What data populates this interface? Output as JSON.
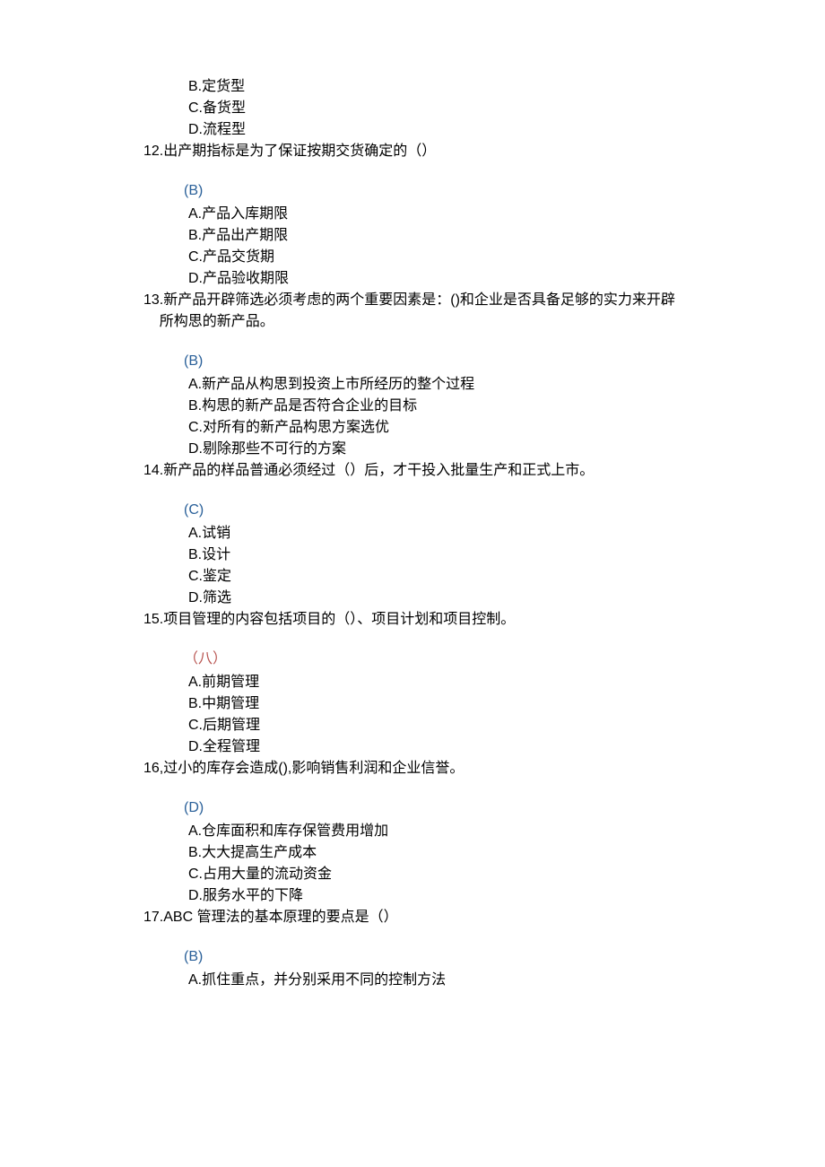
{
  "partial_options": [
    "B.定货型",
    "C.备货型",
    "D.流程型"
  ],
  "questions": [
    {
      "num": "12. ",
      "text": "出产期指标是为了保证按期交货确定的（）",
      "answer": "(B)",
      "answer_style": "blue",
      "options": [
        "A.产品入库期限",
        "B.产品出产期限",
        "C.产品交货期",
        "D.产品验收期限"
      ]
    },
    {
      "num": "13 ",
      "text": ".新产品开辟筛选必须考虑的两个重要因素是：()和企业是否具备足够的实力来开辟所构思的新产品。",
      "answer": "(B)",
      "answer_style": "blue",
      "options": [
        "A.新产品从构思到投资上市所经历的整个过程",
        "B.构思的新产品是否符合企业的目标",
        "C.对所有的新产品构思方案选优",
        "D.剔除那些不可行的方案"
      ]
    },
    {
      "num": "14 ",
      "text": " .新产品的样品普通必须经过（）后，才干投入批量生产和正式上市。",
      "answer": "(C)",
      "answer_style": "blue",
      "options": [
        "A.试销",
        "B.设计",
        "C.鉴定",
        "D.筛选"
      ]
    },
    {
      "num": "15 ",
      "text": " .项目管理的内容包括项目的（）、项目计划和项目控制。",
      "answer": "（八）",
      "answer_style": "red",
      "options": [
        "A.前期管理",
        "B.中期管理",
        "C.后期管理",
        "D.全程管理"
      ]
    },
    {
      "num": "16, ",
      "text": "过小的库存会造成(),影响销售利润和企业信誉。",
      "answer": "(D)",
      "answer_style": "blue",
      "options": [
        "A.仓库面积和库存保管费用增加",
        "B.大大提高生产成本",
        "C.占用大量的流动资金",
        "D.服务水平的下降"
      ]
    },
    {
      "num": "17.",
      "text": "ABC 管理法的基本原理的要点是（）",
      "answer": "(B)",
      "answer_style": "blue",
      "options": [
        "A.抓住重点，并分别采用不同的控制方法"
      ]
    }
  ]
}
